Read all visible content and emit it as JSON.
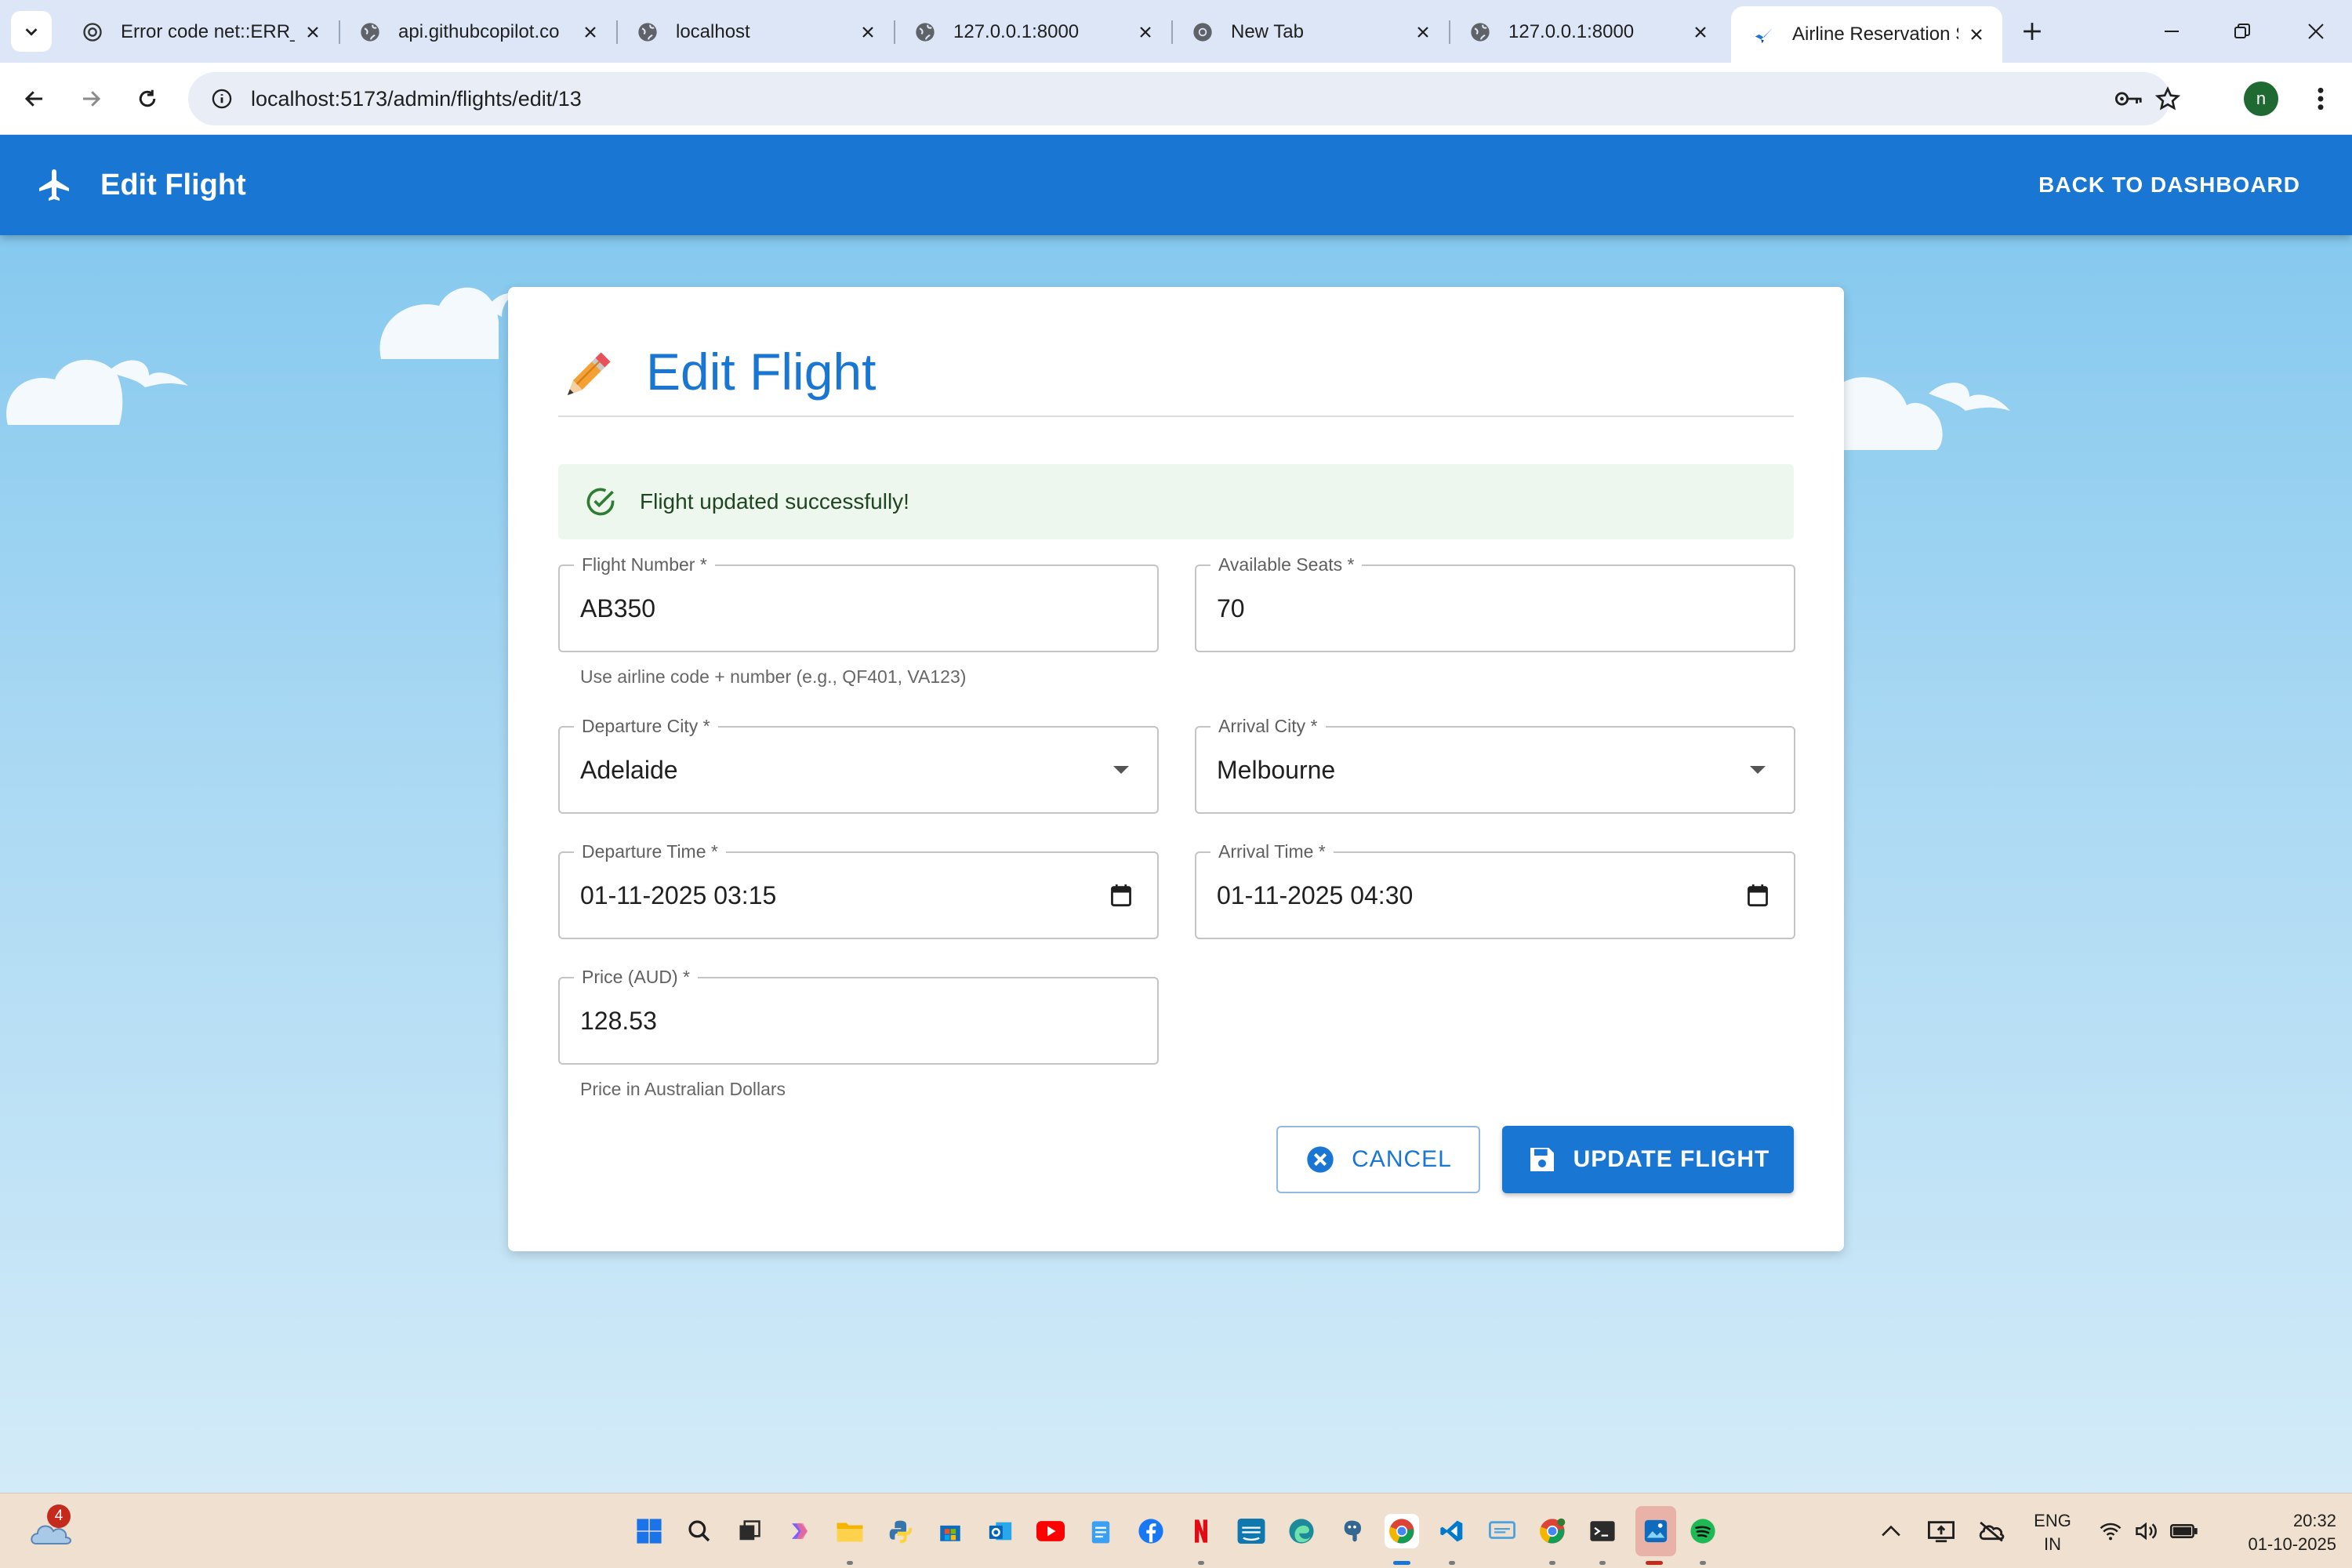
{
  "browser": {
    "tabs": [
      {
        "title": "Error code net::ERR_",
        "favicon": "openai-icon"
      },
      {
        "title": "api.githubcopilot.co",
        "favicon": "globe-icon"
      },
      {
        "title": "localhost",
        "favicon": "globe-icon"
      },
      {
        "title": "127.0.0.1:8000",
        "favicon": "globe-icon"
      },
      {
        "title": "New Tab",
        "favicon": "chrome-icon"
      },
      {
        "title": "127.0.0.1:8000",
        "favicon": "globe-icon"
      },
      {
        "title": "Airline Reservation S",
        "favicon": "airline-icon",
        "active": true
      }
    ],
    "url": "localhost:5173/admin/flights/edit/13",
    "profile_initial": "n"
  },
  "appbar": {
    "title": "Edit Flight",
    "back_label": "BACK TO DASHBOARD"
  },
  "form": {
    "heading": "Edit Flight",
    "alert": "Flight updated successfully!",
    "flight_number": {
      "label": "Flight Number *",
      "value": "AB350",
      "helper": "Use airline code + number (e.g., QF401, VA123)"
    },
    "available_seats": {
      "label": "Available Seats *",
      "value": "70"
    },
    "departure_city": {
      "label": "Departure City *",
      "value": "Adelaide"
    },
    "arrival_city": {
      "label": "Arrival City *",
      "value": "Melbourne"
    },
    "departure_time": {
      "label": "Departure Time *",
      "value": "01-11-2025 03:15"
    },
    "arrival_time": {
      "label": "Arrival Time *",
      "value": "01-11-2025 04:30"
    },
    "price": {
      "label": "Price (AUD) *",
      "value": "128.53",
      "helper": "Price in Australian Dollars"
    },
    "cancel_label": "CANCEL",
    "update_label": "UPDATE FLIGHT"
  },
  "taskbar": {
    "weather_badge": "4",
    "lang_line1": "ENG",
    "lang_line2": "IN",
    "time": "20:32",
    "date": "01-10-2025"
  },
  "colors": {
    "primary": "#1976d2",
    "success_bg": "#edf7ed",
    "success_fg": "#2e7d32"
  }
}
